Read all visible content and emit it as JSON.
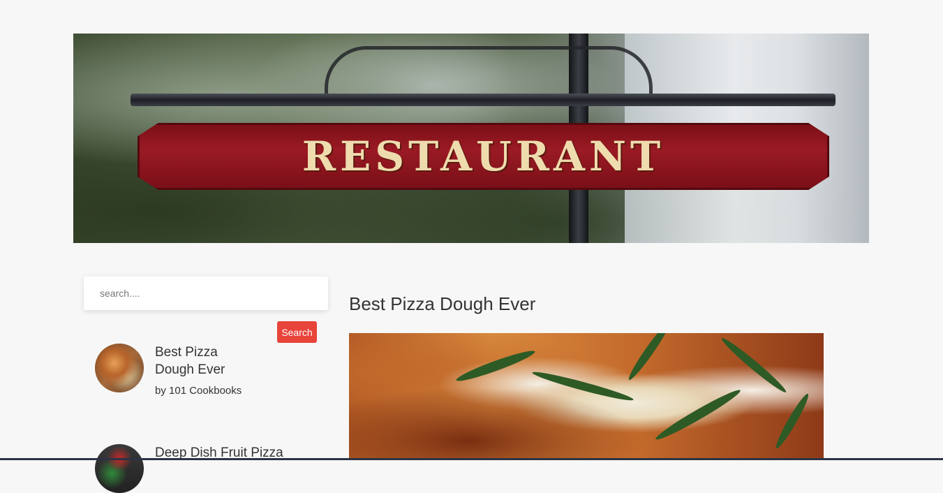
{
  "banner": {
    "sign_text": "RESTAURANT"
  },
  "search": {
    "placeholder": "search....",
    "button_label": "Search"
  },
  "recipes": [
    {
      "title": "Best Pizza Dough Ever",
      "author": "by 101 Cookbooks"
    },
    {
      "title": "Deep Dish Fruit Pizza",
      "author": ""
    }
  ],
  "article": {
    "title": "Best Pizza Dough Ever"
  },
  "colors": {
    "accent": "#e8443a",
    "background": "#f7f7f7",
    "text": "#333333"
  }
}
